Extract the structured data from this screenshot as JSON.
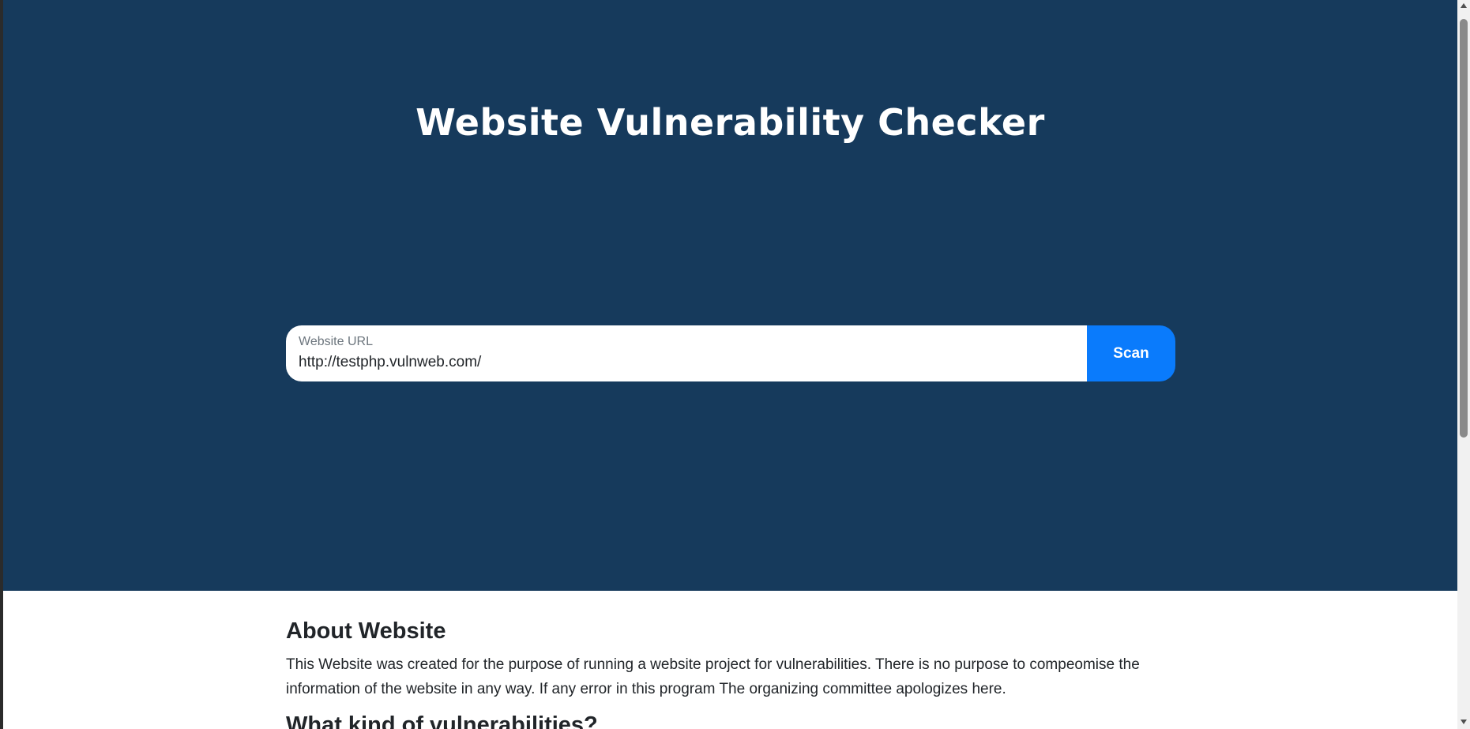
{
  "hero": {
    "title": "Website Vulnerability Checker",
    "background_color": "#163a5c"
  },
  "scan_form": {
    "input_label": "Website URL",
    "input_value": "http://testphp.vulnweb.com/",
    "button_label": "Scan",
    "button_color": "#0a7bfc"
  },
  "about": {
    "heading": "About Website",
    "text": "This Website was created for the purpose of running a website project for vulnerabilities. There is no purpose to compeomise the information of the website in any way. If any error in this program The organizing committee apologizes here.",
    "next_heading": "What kind of vulnerabilities?"
  },
  "icons": {
    "scroll_up": "chevron-up-icon",
    "scroll_down": "chevron-down-icon"
  }
}
